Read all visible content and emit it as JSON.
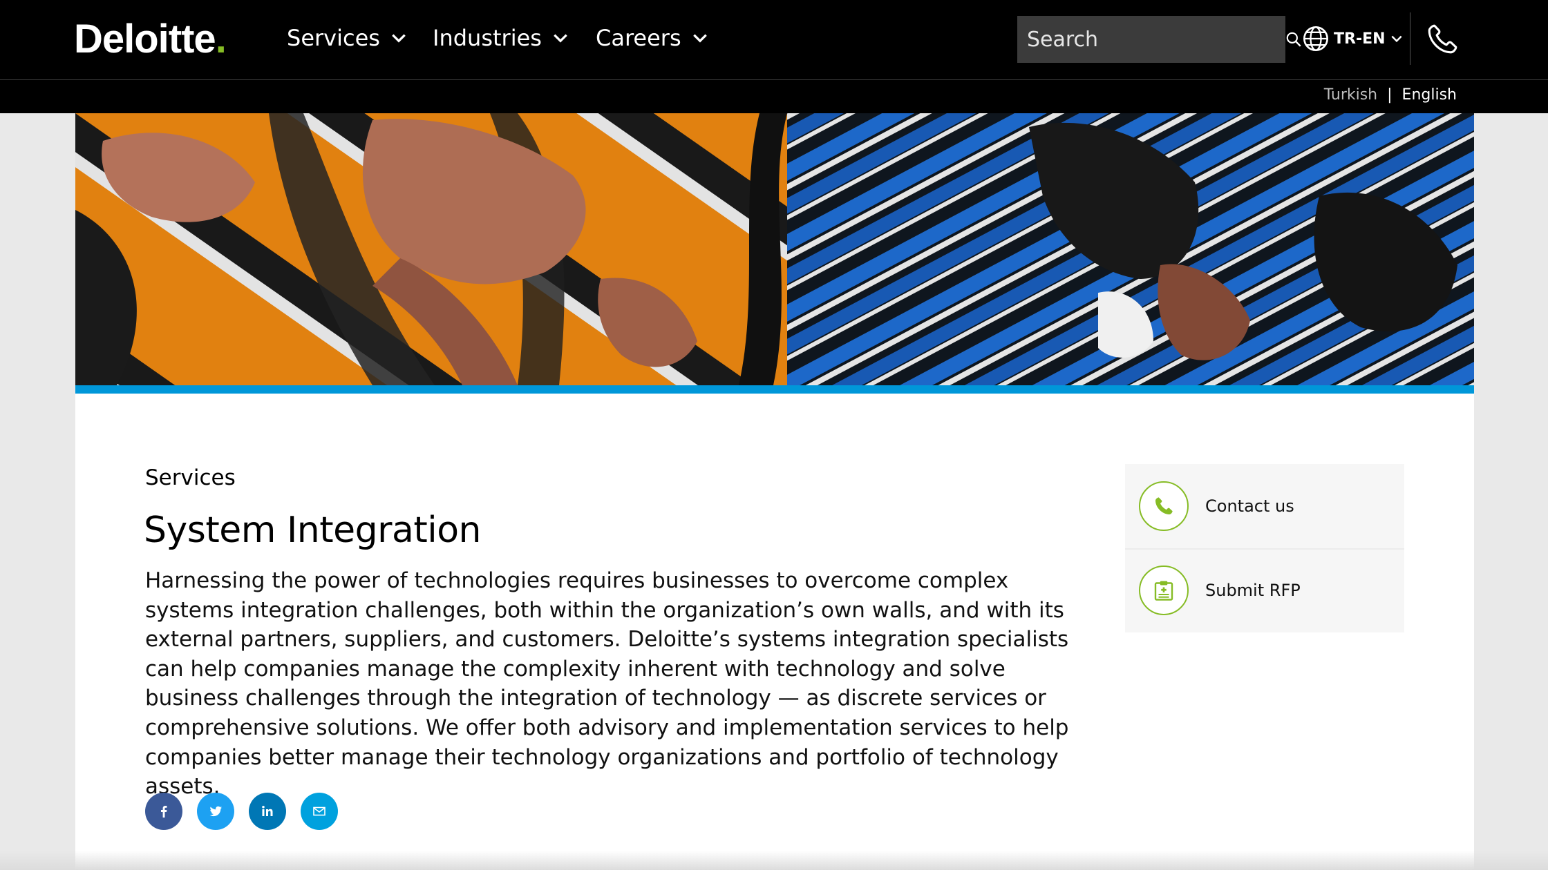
{
  "header": {
    "logo_text": "Deloitte",
    "logo_dot": ".",
    "nav": [
      {
        "label": "Services"
      },
      {
        "label": "Industries"
      },
      {
        "label": "Careers"
      }
    ],
    "search": {
      "placeholder": "Search"
    },
    "locale": "TR-EN"
  },
  "language_bar": {
    "turkish": "Turkish",
    "separator": "|",
    "english": "English"
  },
  "main": {
    "eyebrow": "Services",
    "title": "System Integration",
    "description": "Harnessing the power of technologies requires businesses to overcome complex systems integration challenges, both within the organization’s own walls, and with its external partners, suppliers, and customers. Deloitte’s systems integration specialists can help companies manage the complexity inherent with technology and solve business challenges through the integration of technology — as discrete services or comprehensive solutions. We offer both advisory and implementation services to help companies better manage their technology organizations and portfolio of technology assets."
  },
  "share": [
    {
      "icon": "facebook-icon",
      "color": "#3b5998"
    },
    {
      "icon": "twitter-icon",
      "color": "#1da1f2"
    },
    {
      "icon": "linkedin-icon",
      "color": "#0077b5"
    },
    {
      "icon": "email-icon",
      "color": "#00a1de"
    }
  ],
  "side_panel": {
    "items": [
      {
        "label": "Contact us",
        "icon": "phone-icon"
      },
      {
        "label": "Submit RFP",
        "icon": "rfp-clipboard-icon"
      }
    ]
  },
  "colors": {
    "brand_green": "#86bc25",
    "accent_blue": "#0097d9",
    "header_bg": "#000000"
  }
}
